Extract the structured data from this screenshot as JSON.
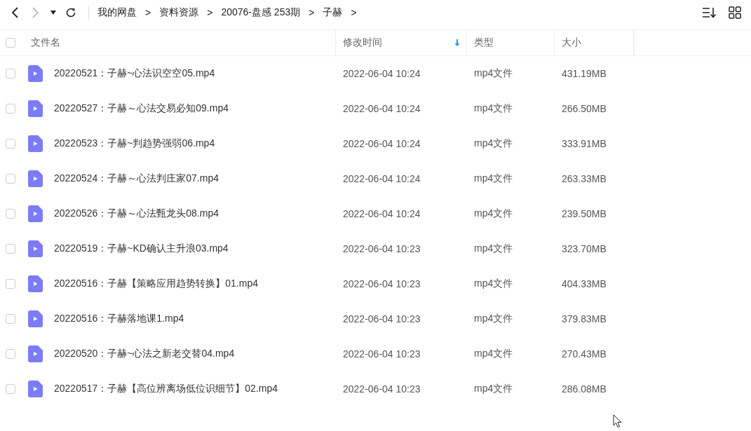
{
  "toolbar": {
    "back": {
      "disabled": false
    },
    "forward": {
      "disabled": true
    },
    "breadcrumb": [
      {
        "label": "我的网盘",
        "separator": ">"
      },
      {
        "label": "资料资源",
        "separator": ">"
      },
      {
        "label": "20076-盘感 253期",
        "separator": ">"
      },
      {
        "label": "子赫",
        "separator": ">"
      }
    ]
  },
  "table": {
    "select_all": {
      "checked": false
    },
    "columns": [
      {
        "label": "文件名",
        "sorted": false
      },
      {
        "label": "修改时间",
        "sorted": true
      },
      {
        "label": "类型",
        "sorted": false
      },
      {
        "label": "大小",
        "sorted": false
      }
    ],
    "rows": [
      {
        "checked": false,
        "name": "20220521：子赫~心法识空空05.mp4",
        "modified": "2022-06-04 10:24",
        "type": "mp4文件",
        "size": "431.19MB"
      },
      {
        "checked": false,
        "name": "20220527：子赫～心法交易必知09.mp4",
        "modified": "2022-06-04 10:24",
        "type": "mp4文件",
        "size": "266.50MB"
      },
      {
        "checked": false,
        "name": "20220523：子赫~判趋势强弱06.mp4",
        "modified": "2022-06-04 10:24",
        "type": "mp4文件",
        "size": "333.91MB"
      },
      {
        "checked": false,
        "name": "20220524：子赫～心法判庄家07.mp4",
        "modified": "2022-06-04 10:24",
        "type": "mp4文件",
        "size": "263.33MB"
      },
      {
        "checked": false,
        "name": "20220526：子赫～心法甄龙头08.mp4",
        "modified": "2022-06-04 10:24",
        "type": "mp4文件",
        "size": "239.50MB"
      },
      {
        "checked": false,
        "name": "20220519：子赫~KD确认主升浪03.mp4",
        "modified": "2022-06-04 10:23",
        "type": "mp4文件",
        "size": "323.70MB"
      },
      {
        "checked": false,
        "name": "20220516：子赫【策略应用趋势转换】01.mp4",
        "modified": "2022-06-04 10:23",
        "type": "mp4文件",
        "size": "404.33MB"
      },
      {
        "checked": false,
        "name": "20220516：子赫落地课1.mp4",
        "modified": "2022-06-04 10:23",
        "type": "mp4文件",
        "size": "379.83MB"
      },
      {
        "checked": false,
        "name": "20220520：子赫~心法之新老交替04.mp4",
        "modified": "2022-06-04 10:23",
        "type": "mp4文件",
        "size": "270.43MB"
      },
      {
        "checked": false,
        "name": "20220517：子赫【高位辨离场低位识细节】02.mp4",
        "modified": "2022-06-04 10:23",
        "type": "mp4文件",
        "size": "286.08MB"
      }
    ]
  }
}
